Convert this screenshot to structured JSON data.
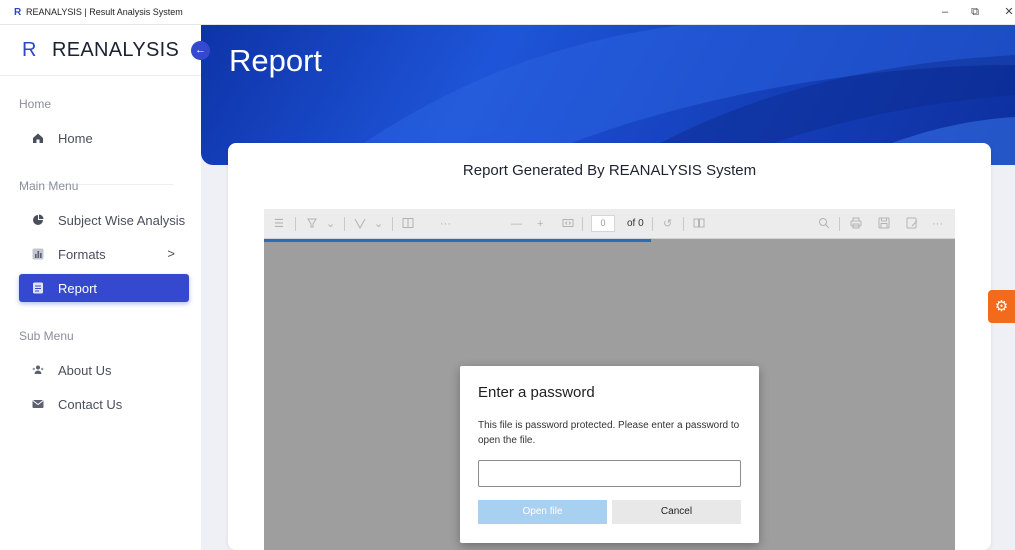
{
  "window": {
    "icon_letter": "R",
    "title": "REANALYSIS | Result Analysis System",
    "controls": {
      "minimize": "–",
      "restore": "⧉",
      "close": "✕"
    }
  },
  "sidebar": {
    "brand_letter": "R",
    "brand_name": "REANALYSIS",
    "sections": [
      {
        "label": "Home"
      },
      {
        "label": "Main Menu"
      },
      {
        "label": "Sub Menu"
      }
    ],
    "items": [
      {
        "label": "Home",
        "icon": "home-icon"
      },
      {
        "label": "Subject Wise Analysis",
        "icon": "pie-chart-icon"
      },
      {
        "label": "Formats",
        "icon": "bar-chart-icon",
        "chevron": ">"
      },
      {
        "label": "Report",
        "icon": "document-icon",
        "active": true
      },
      {
        "label": "About Us",
        "icon": "users-icon"
      },
      {
        "label": "Contact Us",
        "icon": "envelope-icon"
      }
    ]
  },
  "header": {
    "title": "Report"
  },
  "card": {
    "title": "Report Generated By REANALYSIS System"
  },
  "viewer": {
    "page_number": "0",
    "page_of": "of 0",
    "progress": 0.56
  },
  "dialog": {
    "title": "Enter a password",
    "message": "This file is password protected. Please enter a password to open the file.",
    "password_value": "",
    "open_label": "Open file",
    "cancel_label": "Cancel"
  },
  "colors": {
    "accent": "#3448d0",
    "hero": "#1846c4",
    "settings_tab": "#f26a1b",
    "open_button": "#a8d0f1"
  }
}
